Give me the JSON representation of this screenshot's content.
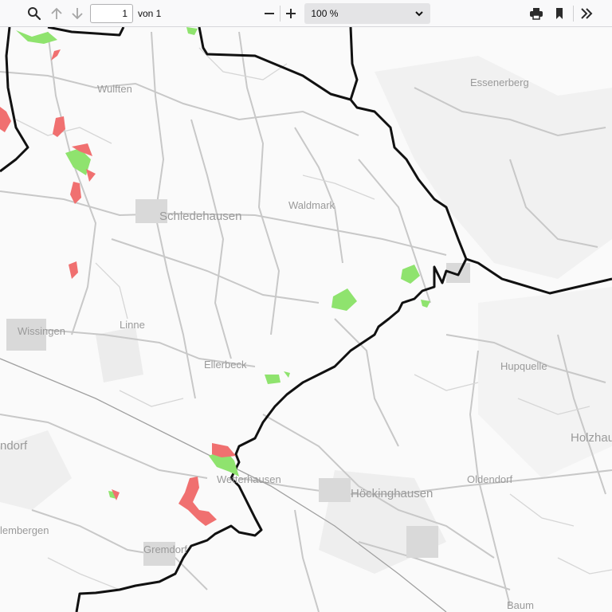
{
  "toolbar": {
    "page_current": "1",
    "page_total_label": "von 1",
    "zoom_value": "100 %"
  },
  "icons": [
    "search-icon",
    "arrow-up-icon",
    "arrow-down-icon",
    "minus-icon",
    "plus-icon",
    "chevron-down-icon",
    "print-icon",
    "bookmark-icon",
    "chevron-double-right-icon"
  ],
  "map": {
    "places": {
      "essenerberg": "Essenerberg",
      "wulften": "Wulften",
      "schledehausen": "Schledehausen",
      "waldmark": "Waldmark",
      "wissingen": "Wissingen",
      "linne": "Linne",
      "ellerbeck": "Ellerbeck",
      "hupquelle": "Hupquelle",
      "holzhausen": "Holzhausen",
      "ndorf": "ndorf",
      "wetterhausen": "Wetterhausen",
      "oldendorf": "Oldendorf",
      "hockinghausen": "Höckinghausen",
      "lemergen": "lembergen",
      "gremdorf": "Gremdorf",
      "baum": "Baum"
    },
    "colors": {
      "boundary": "#111111",
      "green_area": "#8fe36e",
      "red_area": "#f07070",
      "road": "#c8c8c8",
      "railway": "#a0a0a0"
    }
  }
}
